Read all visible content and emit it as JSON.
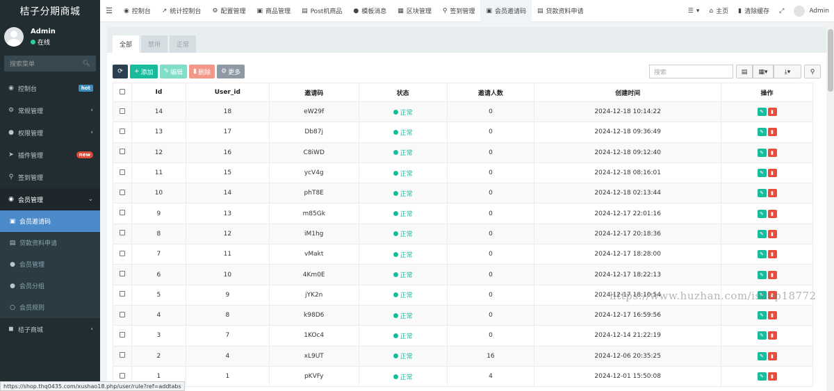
{
  "brand": "桔子分期商城",
  "user": {
    "name": "Admin",
    "status": "在线"
  },
  "sidebar": {
    "search_placeholder": "搜索菜单",
    "items": [
      {
        "label": "控制台",
        "icon": "dashboard-icon",
        "badge": "hot"
      },
      {
        "label": "常规管理",
        "icon": "cogs-icon"
      },
      {
        "label": "权限管理",
        "icon": "group-icon"
      },
      {
        "label": "插件管理",
        "icon": "rocket-icon",
        "badge": "new"
      },
      {
        "label": "签到管理",
        "icon": "map-marker-icon"
      },
      {
        "label": "会员管理",
        "icon": "user-circle-icon"
      }
    ],
    "sub_items": [
      {
        "label": "会员邀请码",
        "icon": "lock-icon"
      },
      {
        "label": "贷款资料申请",
        "icon": "id-card-icon"
      },
      {
        "label": "会员管理",
        "icon": "user-icon"
      },
      {
        "label": "会员分组",
        "icon": "users-icon"
      },
      {
        "label": "会员规则",
        "icon": "circle-o-icon"
      }
    ],
    "last_item": {
      "label": "桔子商城",
      "icon": "cube-icon"
    }
  },
  "topbar": {
    "tabs": [
      "控制台",
      "统计控制台",
      "配置管理",
      "商品管理",
      "Post机商品",
      "模板消息",
      "区块管理",
      "签到管理",
      "会员邀请码",
      "贷款资料申请"
    ],
    "right": {
      "home": "主页",
      "clear_cache": "清除缓存",
      "admin": "Admin"
    }
  },
  "panel_tabs": [
    "全部",
    "禁用",
    "正常"
  ],
  "toolbar": {
    "add": "添加",
    "edit": "编辑",
    "delete": "删除",
    "more": "更多",
    "search_placeholder": "搜索"
  },
  "table": {
    "headers": [
      "Id",
      "User_id",
      "邀请码",
      "状态",
      "邀请人数",
      "创建时间",
      "操作"
    ],
    "rows": [
      {
        "id": "14",
        "user_id": "18",
        "code": "eW29f",
        "status": "正常",
        "count": "0",
        "created": "2024-12-18 10:14:22"
      },
      {
        "id": "13",
        "user_id": "17",
        "code": "Db87j",
        "status": "正常",
        "count": "0",
        "created": "2024-12-18 09:36:49"
      },
      {
        "id": "12",
        "user_id": "16",
        "code": "C8iWD",
        "status": "正常",
        "count": "0",
        "created": "2024-12-18 09:12:40"
      },
      {
        "id": "11",
        "user_id": "15",
        "code": "ycV4g",
        "status": "正常",
        "count": "0",
        "created": "2024-12-18 08:16:01"
      },
      {
        "id": "10",
        "user_id": "14",
        "code": "phT8E",
        "status": "正常",
        "count": "0",
        "created": "2024-12-18 02:13:44"
      },
      {
        "id": "9",
        "user_id": "13",
        "code": "m85Gk",
        "status": "正常",
        "count": "0",
        "created": "2024-12-17 22:01:16"
      },
      {
        "id": "8",
        "user_id": "12",
        "code": "iM1hg",
        "status": "正常",
        "count": "0",
        "created": "2024-12-17 20:18:36"
      },
      {
        "id": "7",
        "user_id": "11",
        "code": "vMakt",
        "status": "正常",
        "count": "0",
        "created": "2024-12-17 18:28:00"
      },
      {
        "id": "6",
        "user_id": "10",
        "code": "4Km0E",
        "status": "正常",
        "count": "0",
        "created": "2024-12-17 18:22:13"
      },
      {
        "id": "5",
        "user_id": "9",
        "code": "jYK2n",
        "status": "正常",
        "count": "0",
        "created": "2024-12-17 18:10:54"
      },
      {
        "id": "4",
        "user_id": "8",
        "code": "k98D6",
        "status": "正常",
        "count": "0",
        "created": "2024-12-17 16:59:56"
      },
      {
        "id": "3",
        "user_id": "7",
        "code": "1KOc4",
        "status": "正常",
        "count": "0",
        "created": "2024-12-14 21:22:19"
      },
      {
        "id": "2",
        "user_id": "4",
        "code": "xL9UT",
        "status": "正常",
        "count": "16",
        "created": "2024-12-06 20:35:25"
      },
      {
        "id": "1",
        "user_id": "1",
        "code": "pKVFy",
        "status": "正常",
        "count": "4",
        "created": "2024-12-01 15:50:08"
      }
    ]
  },
  "status_url": "https://shop.thq0435.com/xushao18.php/user/rule?ref=addtabs",
  "watermark": "https://www.huzhan.com/ishop18772"
}
